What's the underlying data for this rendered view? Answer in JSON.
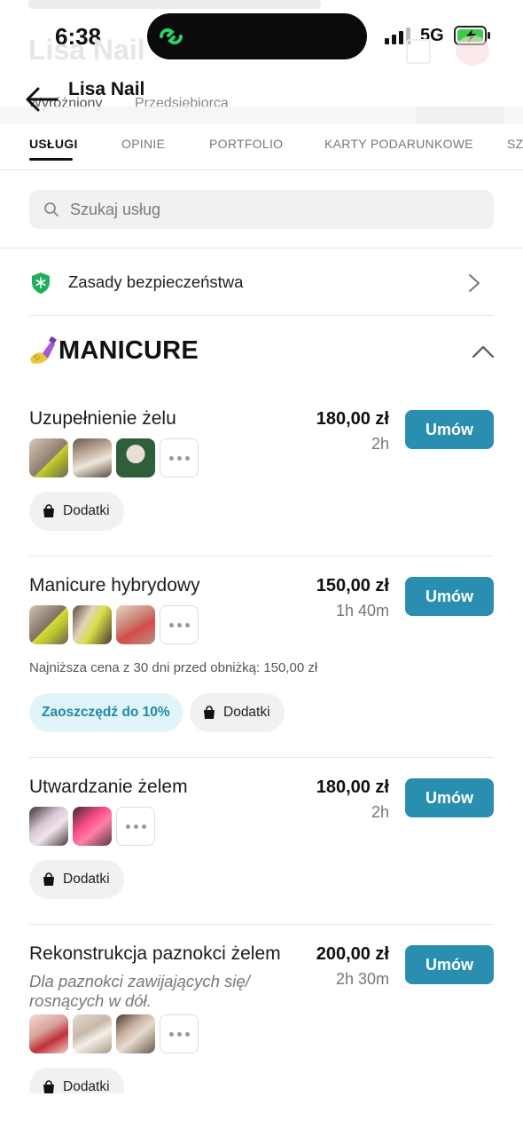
{
  "status_bar": {
    "time": "6:38",
    "network": "5G"
  },
  "background_header": {
    "salon_name": "Lisa Nail",
    "sub_left": "Wyróżniony",
    "sub_right": "Przedsiębiorca"
  },
  "header": {
    "title": "Lisa Nail"
  },
  "tabs": [
    {
      "label": "USŁUGI",
      "active": true
    },
    {
      "label": "OPINIE",
      "active": false
    },
    {
      "label": "PORTFOLIO",
      "active": false
    },
    {
      "label": "KARTY PODARUNKOWE",
      "active": false
    },
    {
      "label": "SZC",
      "active": false
    }
  ],
  "search": {
    "placeholder": "Szukaj usług",
    "value": ""
  },
  "safety": {
    "label": "Zasady bezpieczeństwa"
  },
  "category": {
    "title": "MANICURE",
    "emoji": "nail-polish",
    "expanded": true
  },
  "services": [
    {
      "name": "Uzupełnienie żelu",
      "price": "180,00 zł",
      "duration": "2h",
      "book_label": "Umów",
      "photos": 3,
      "addons_label": "Dodatki"
    },
    {
      "name": "Manicure hybrydowy",
      "price": "150,00 zł",
      "duration": "1h 40m",
      "book_label": "Umów",
      "photos": 3,
      "lowest_price_note": "Najniższa cena z 30 dni przed obniżką: 150,00 zł",
      "discount_label": "Zaoszczędź do 10%",
      "addons_label": "Dodatki"
    },
    {
      "name": "Utwardzanie żelem",
      "price": "180,00 zł",
      "duration": "2h",
      "book_label": "Umów",
      "photos": 2,
      "addons_label": "Dodatki"
    },
    {
      "name": "Rekonstrukcja paznokci żelem",
      "description": "Dla paznokci zawijających się/ rosnących w dół.",
      "price": "200,00 zł",
      "duration": "2h 30m",
      "book_label": "Umów",
      "photos": 3,
      "addons_label": "Dodatki"
    }
  ],
  "colors": {
    "accent": "#2a8eb1",
    "discount_bg": "#e1f4f7",
    "shield_green": "#1fae5b"
  }
}
